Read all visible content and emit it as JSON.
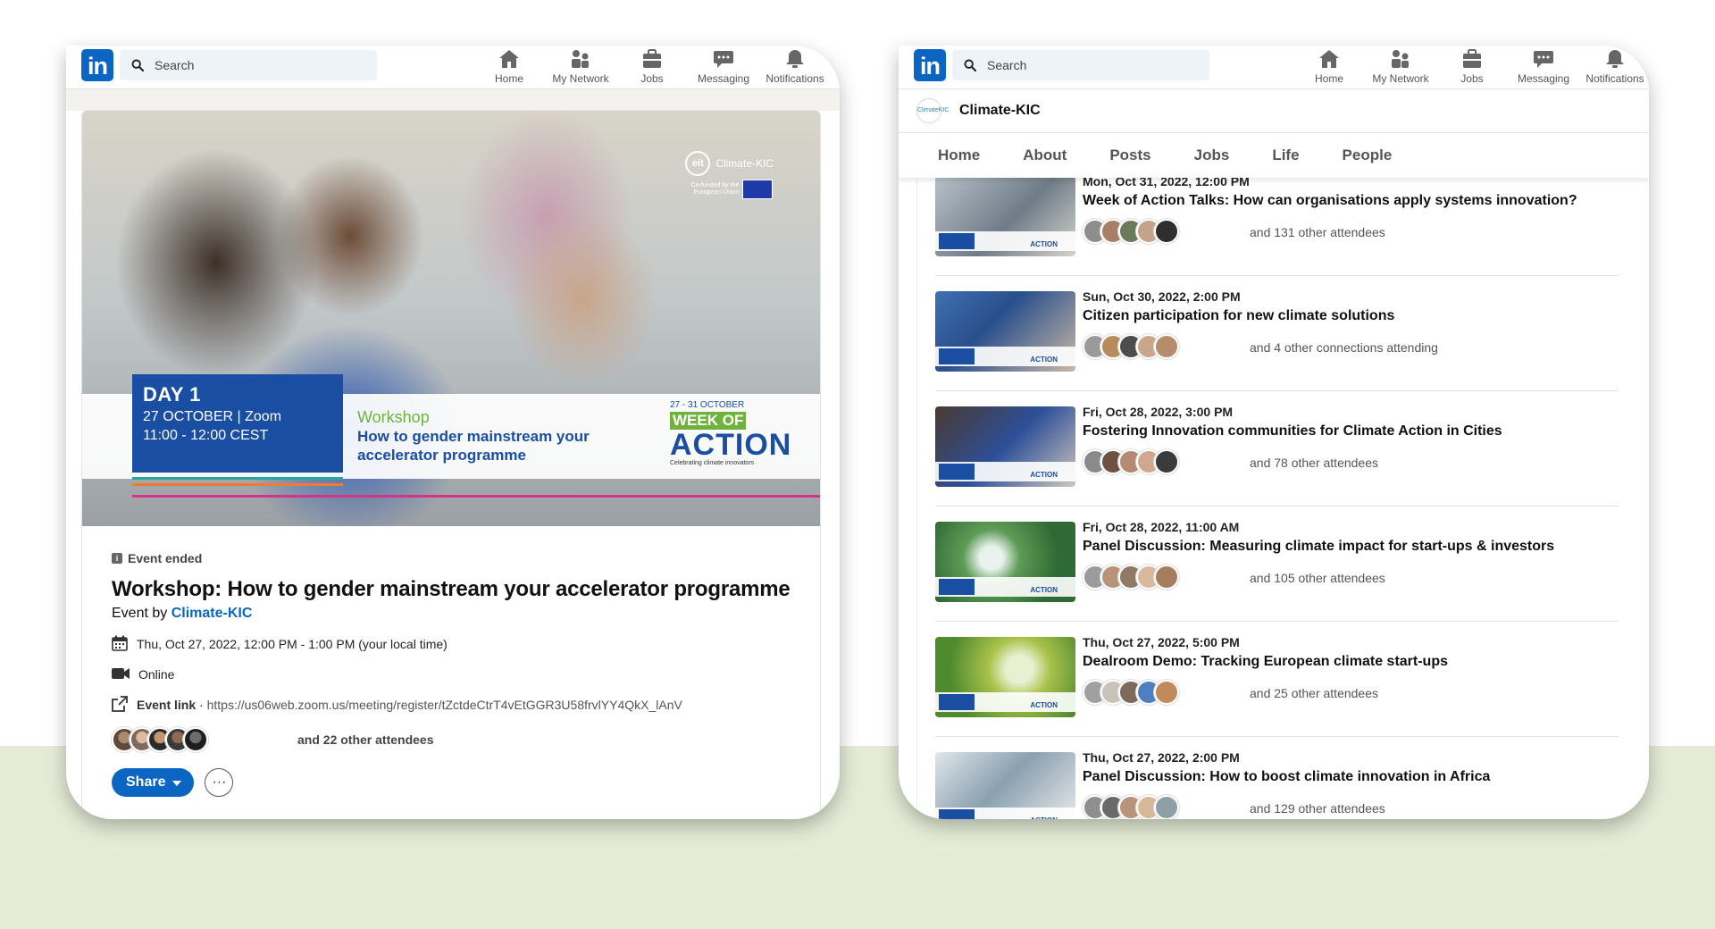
{
  "nav": {
    "logo": "in",
    "search_placeholder": "Search",
    "items": [
      {
        "label": "Home",
        "icon": "home-icon"
      },
      {
        "label": "My Network",
        "icon": "network-icon"
      },
      {
        "label": "Jobs",
        "icon": "jobs-icon"
      },
      {
        "label": "Messaging",
        "icon": "messaging-icon"
      },
      {
        "label": "Notifications",
        "icon": "bell-icon"
      }
    ]
  },
  "event": {
    "hero": {
      "logo_text": "Climate-KIC",
      "logo_ring": "eit",
      "cofunded": "Co-funded by the European Union",
      "day": "DAY 1",
      "date_line1": "27 OCTOBER | Zoom",
      "date_line2": "11:00 - 12:00 CEST",
      "workshop_label": "Workshop",
      "workshop_title": "How to gender mainstream your accelerator programme",
      "woa_dates": "27 - 31 OCTOBER",
      "woa_week": "WEEK OF",
      "woa_action": "ACTION",
      "woa_tagline": "Celebrating climate innovators"
    },
    "status": "Event ended",
    "title": "Workshop: How to gender mainstream your accelerator programme",
    "by_prefix": "Event by",
    "organizer": "Climate-KIC",
    "datetime": "Thu, Oct 27, 2022, 12:00 PM - 1:00 PM (your local time)",
    "location": "Online",
    "link_label": "Event link",
    "link_sep": " · ",
    "link_url": "https://us06web.zoom.us/meeting/register/tZctdeCtrT4vEtGGR3U58frvlYY4QkX_lAnV",
    "attendees_text": "and 22 other attendees",
    "share_label": "Share",
    "more_label": "···"
  },
  "company": {
    "name": "Climate-KIC",
    "logo_text": "ClimateKIC",
    "tabs": [
      "Home",
      "About",
      "Posts",
      "Jobs",
      "Life",
      "People"
    ]
  },
  "events_list": [
    {
      "date": "Mon, Oct 31, 2022, 12:00 PM",
      "title": "Week of Action Talks: How can organisations apply systems innovation?",
      "attendees": "and 131 other attendees"
    },
    {
      "date": "Sun, Oct 30, 2022, 2:00 PM",
      "title": "Citizen participation for new climate solutions",
      "attendees": "and 4 other connections attending"
    },
    {
      "date": "Fri, Oct 28, 2022, 3:00 PM",
      "title": "Fostering Innovation communities for Climate Action in Cities",
      "attendees": "and 78 other attendees"
    },
    {
      "date": "Fri, Oct 28, 2022, 11:00 AM",
      "title": "Panel Discussion: Measuring climate impact for start-ups & investors",
      "attendees": "and 105 other attendees"
    },
    {
      "date": "Thu, Oct 27, 2022, 5:00 PM",
      "title": "Dealroom Demo: Tracking European climate start-ups",
      "attendees": "and 25 other attendees"
    },
    {
      "date": "Thu, Oct 27, 2022, 2:00 PM",
      "title": "Panel Discussion: How to boost climate innovation in Africa",
      "attendees": "and 129 other attendees"
    }
  ],
  "colors": {
    "linkedin_blue": "#0a66c2",
    "eit_blue": "#1a4ea2",
    "eit_green": "#6fb23d",
    "background_band": "#e4ecd7"
  }
}
